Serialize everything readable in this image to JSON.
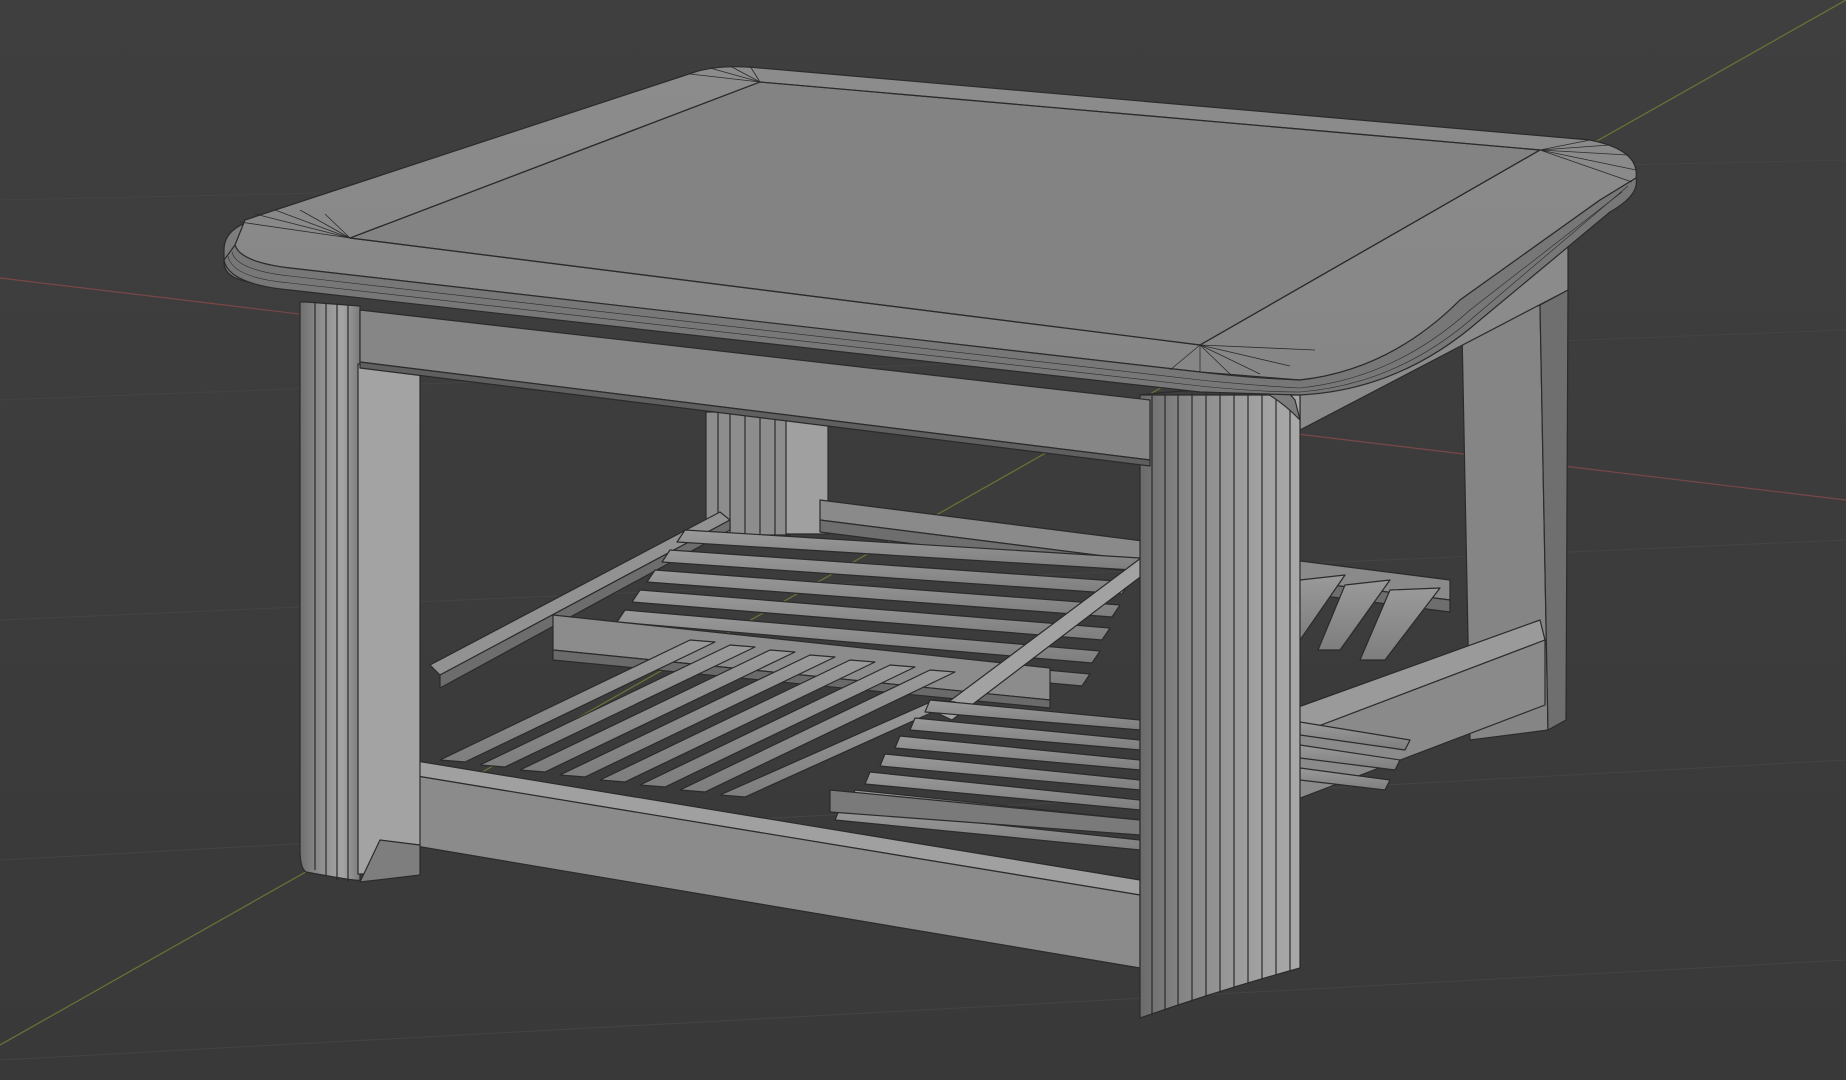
{
  "viewport": {
    "background_color": "#3d3d3d",
    "floor_line_color": "#4a4a4a",
    "x_axis_color": "#8a4d4d",
    "y_axis_color": "#7d8a3c"
  },
  "model": {
    "object": "coffee table",
    "shading": "solid",
    "wireframe_overlay": true,
    "base_color": "#8f8f8f",
    "edge_color": "#2a2a2a",
    "parts": [
      "tabletop",
      "front-left-leg",
      "front-right-leg",
      "back-left-leg",
      "back-right-leg",
      "apron",
      "lower-shelf-slats",
      "shelf-rails"
    ]
  }
}
